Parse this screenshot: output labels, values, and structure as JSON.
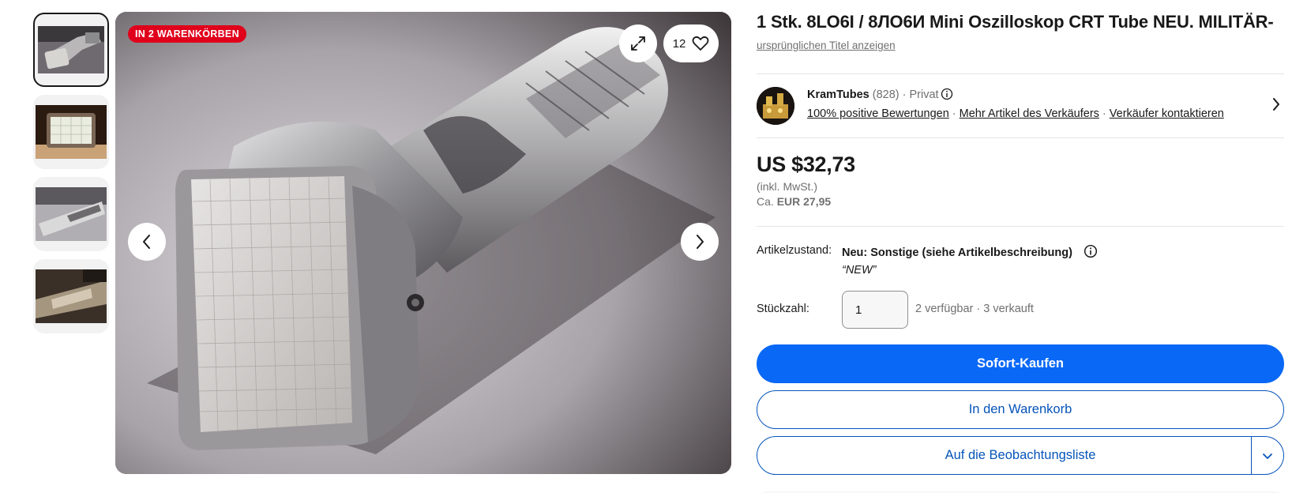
{
  "gallery": {
    "cart_badge": "IN 2 WARENKÖRBEN",
    "watch_count": "12",
    "thumbnails": [
      "thumb-crt-tube",
      "thumb-oscilloscope-screen",
      "thumb-tube-side",
      "thumb-tube-closeup"
    ]
  },
  "listing": {
    "title": "1 Stk. 8LO6I / 8ЛО6И Mini Oszilloskop CRT Tube NEU. MILITÄR-",
    "original_title_link": "ursprünglichen Titel anzeigen"
  },
  "seller": {
    "name": "KramTubes",
    "feedback_count": "(828)",
    "separator": "·",
    "type": "Privat",
    "positive_feedback": "100% positive Bewertungen",
    "more_items": "Mehr Artikel des Verkäufers",
    "contact": "Verkäufer kontaktieren"
  },
  "price": {
    "amount": "US $32,73",
    "tax_note": "(inkl. MwSt.)",
    "approx_prefix": "Ca.",
    "approx_amount": "EUR 27,95"
  },
  "details": {
    "condition_label": "Artikelzustand:",
    "condition_value": "Neu: Sonstige (siehe Artikelbeschreibung)",
    "condition_note": "“NEW”",
    "quantity_label": "Stückzahl:",
    "quantity_value": "1",
    "availability": "2 verfügbar · 3 verkauft"
  },
  "actions": {
    "buy_now": "Sofort-Kaufen",
    "add_to_cart": "In den Warenkorb",
    "add_to_watchlist": "Auf die Beobachtungsliste"
  },
  "colors": {
    "primary": "#0968f6",
    "link_blue": "#0654ba",
    "badge_red": "#e0001b",
    "text": "#191919",
    "muted": "#707070"
  },
  "icons": [
    "expand-icon",
    "heart-icon",
    "chevron-left-icon",
    "chevron-right-icon",
    "info-icon",
    "chevron-down-icon"
  ]
}
